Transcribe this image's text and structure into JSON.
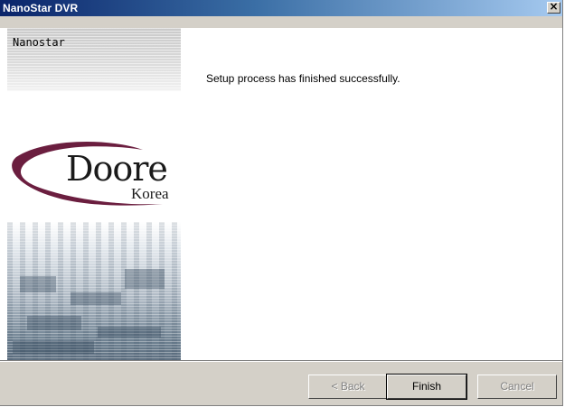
{
  "window": {
    "title": "NanoStar DVR",
    "close_glyph": "×"
  },
  "side_panel": {
    "header_label": "Nanostar",
    "logo": {
      "brand": "Doore",
      "subtitle": "Korea",
      "swoosh_color": "#6b1e3f"
    }
  },
  "main": {
    "message": "Setup process has finished successfully."
  },
  "buttons": {
    "back": "< Back",
    "finish": "Finish",
    "cancel": "Cancel"
  }
}
